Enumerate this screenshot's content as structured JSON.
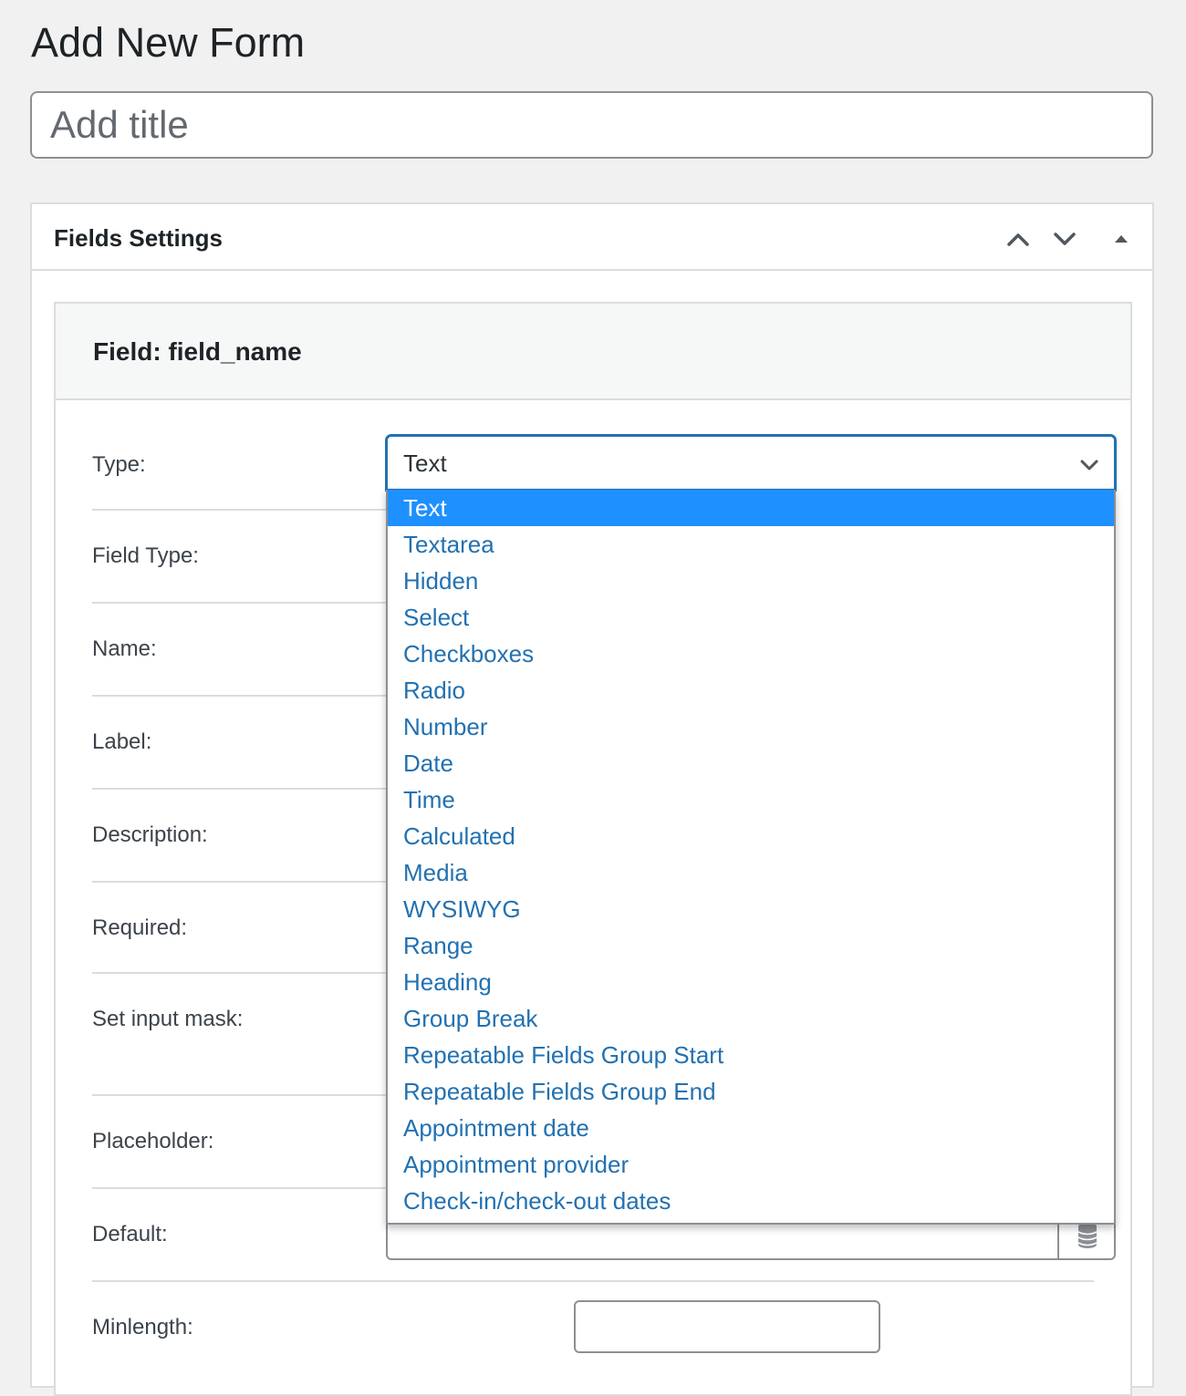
{
  "page": {
    "title": "Add New Form",
    "title_placeholder": "Add title"
  },
  "postbox": {
    "title": "Fields Settings",
    "move_up_icon": "chevron-up-icon",
    "move_down_icon": "chevron-down-icon",
    "toggle_icon": "triangle-up-icon"
  },
  "field": {
    "heading": "Field: field_name",
    "labels": {
      "type": "Type:",
      "field_type": "Field Type:",
      "name": "Name:",
      "label": "Label:",
      "description": "Description:",
      "required": "Required:",
      "input_mask": "Set input mask:",
      "placeholder": "Placeholder:",
      "default": "Default:",
      "minlength": "Minlength:"
    },
    "type_select": {
      "value": "Text",
      "options": [
        "Text",
        "Textarea",
        "Hidden",
        "Select",
        "Checkboxes",
        "Radio",
        "Number",
        "Date",
        "Time",
        "Calculated",
        "Media",
        "WYSIWYG",
        "Range",
        "Heading",
        "Group Break",
        "Repeatable Fields Group Start",
        "Repeatable Fields Group End",
        "Appointment date",
        "Appointment provider",
        "Check-in/check-out dates"
      ],
      "highlighted_option": "Text"
    },
    "default_addon_icon": "database-icon",
    "minlength_value": ""
  },
  "colors": {
    "accent": "#2271b1",
    "highlight": "#1e90ff",
    "border": "#dcdcde",
    "background": "#f1f1f1"
  }
}
